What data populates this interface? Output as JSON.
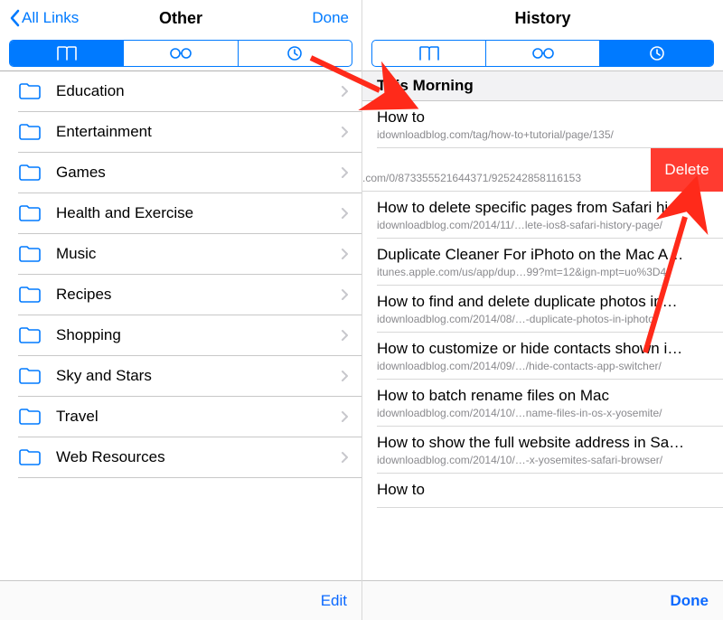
{
  "colors": {
    "tint": "#007aff",
    "delete": "#ff3b30"
  },
  "left": {
    "nav": {
      "back": "All Links",
      "title": "Other",
      "done": "Done"
    },
    "segments": [
      "bookmarks-icon",
      "readinglist-icon",
      "history-icon"
    ],
    "activeSegment": 0,
    "folders": [
      {
        "label": "Education"
      },
      {
        "label": "Entertainment"
      },
      {
        "label": "Games"
      },
      {
        "label": "Health and Exercise"
      },
      {
        "label": "Music"
      },
      {
        "label": "Recipes"
      },
      {
        "label": "Shopping"
      },
      {
        "label": "Sky and Stars"
      },
      {
        "label": "Travel"
      },
      {
        "label": "Web Resources"
      }
    ],
    "toolbar": {
      "edit": "Edit"
    }
  },
  "right": {
    "nav": {
      "title": "History"
    },
    "segments": [
      "bookmarks-icon",
      "readinglist-icon",
      "history-icon"
    ],
    "activeSegment": 2,
    "section": "This Morning",
    "swiped": {
      "url": ".com/0/873355521644371/925242858116153",
      "delete": "Delete"
    },
    "items": [
      {
        "title": "How to",
        "url": "idownloadblog.com/tag/how-to+tutorial/page/135/"
      },
      {
        "title": "How to delete specific pages from Safari hi…",
        "url": "idownloadblog.com/2014/11/…lete-ios8-safari-history-page/"
      },
      {
        "title": "Duplicate Cleaner For iPhoto on the Mac A…",
        "url": "itunes.apple.com/us/app/dup…99?mt=12&ign-mpt=uo%3D4"
      },
      {
        "title": "How to find and delete duplicate photos in…",
        "url": "idownloadblog.com/2014/08/…-duplicate-photos-in-iphoto/"
      },
      {
        "title": "How to customize or hide contacts shown i…",
        "url": "idownloadblog.com/2014/09/…/hide-contacts-app-switcher/"
      },
      {
        "title": "How to batch rename files on Mac",
        "url": "idownloadblog.com/2014/10/…name-files-in-os-x-yosemite/"
      },
      {
        "title": "How to show the full website address in Sa…",
        "url": "idownloadblog.com/2014/10/…-x-yosemites-safari-browser/"
      },
      {
        "title": "How to",
        "url": ""
      }
    ],
    "toolbar": {
      "done": "Done"
    }
  }
}
